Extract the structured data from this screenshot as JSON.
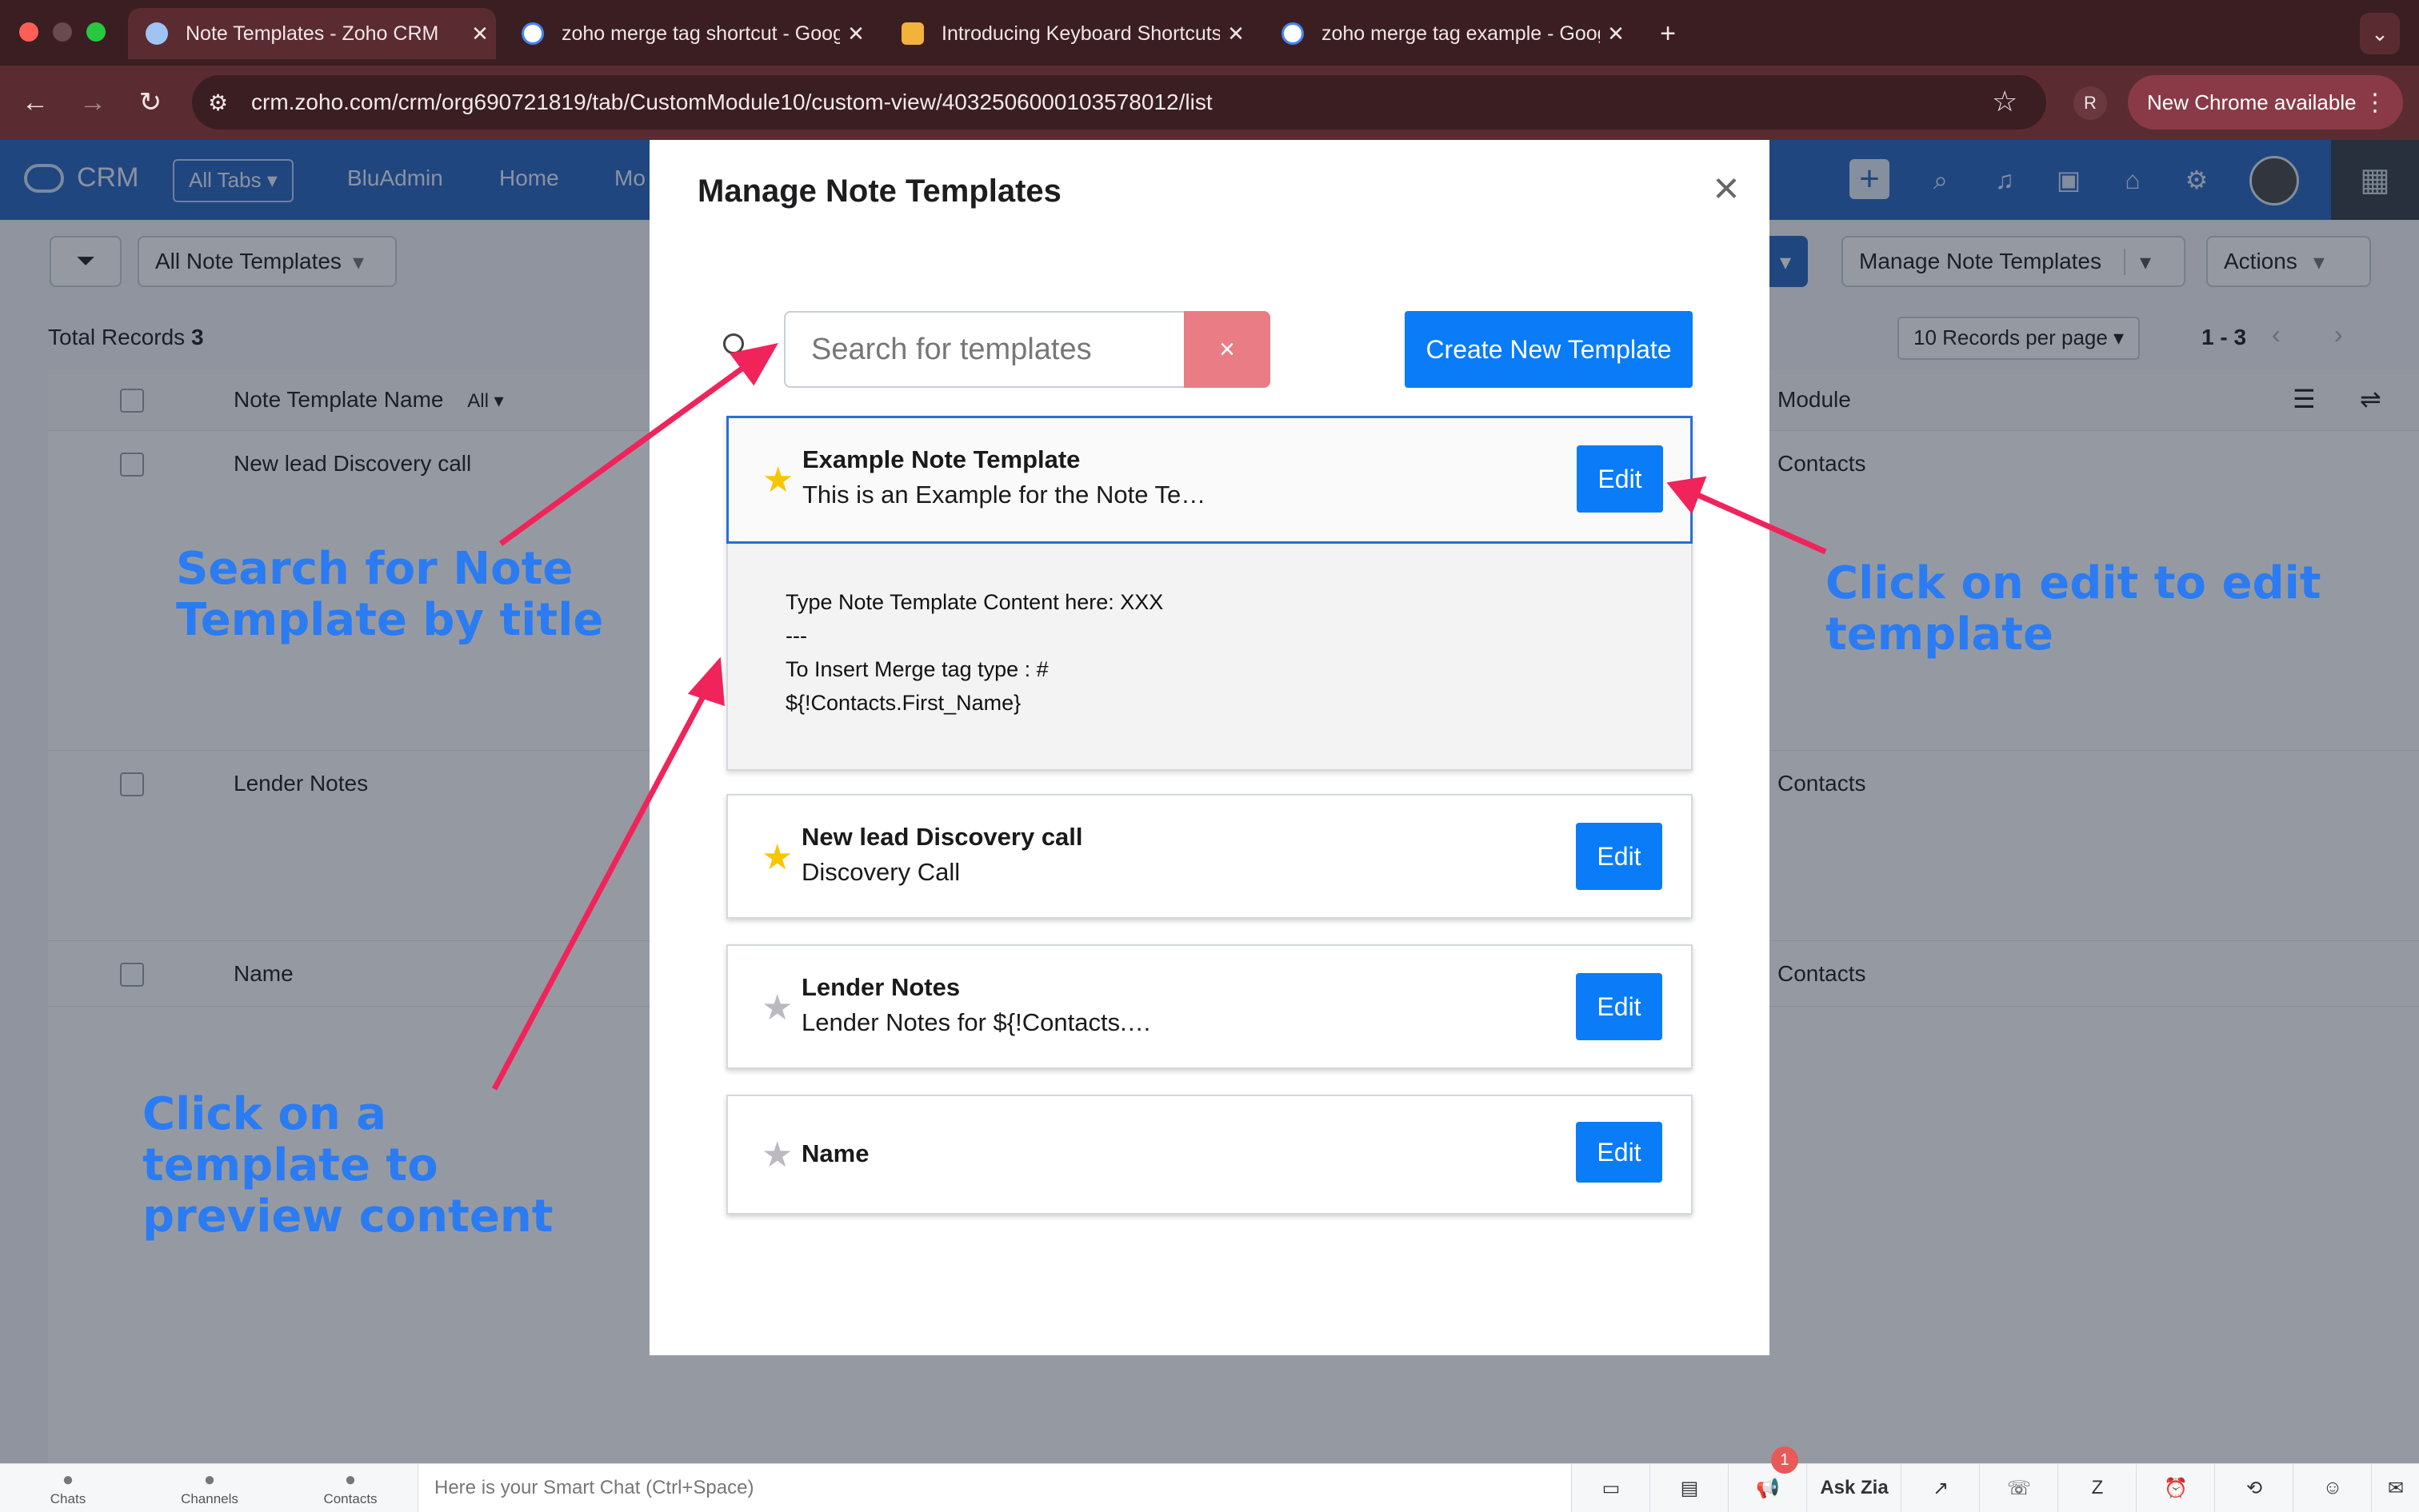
{
  "browser": {
    "tabs": [
      {
        "title": "Note Templates - Zoho CRM",
        "active": true
      },
      {
        "title": "zoho merge tag shortcut - Google Search",
        "active": false
      },
      {
        "title": "Introducing Keyboard Shortcuts",
        "active": false
      },
      {
        "title": "zoho merge tag example - Google Search",
        "active": false
      }
    ],
    "url": "crm.zoho.com/crm/org690721819/tab/CustomModule10/custom-view/4032506000103578012/list",
    "profile_initial": "R",
    "new_chrome_label": "New Chrome available"
  },
  "crm_header": {
    "brand": "CRM",
    "all_tabs_label": "All Tabs",
    "nav_items": [
      "BluAdmin",
      "Home",
      "Mo"
    ]
  },
  "toolbar": {
    "view_label": "All Note Templates",
    "manage_label": "Manage Note Templates",
    "actions_label": "Actions"
  },
  "list": {
    "total_label": "Total Records",
    "total_count": "3",
    "per_page": "10 Records per page",
    "range": "1 - 3",
    "col_name": "Note Template Name",
    "col_filter": "All",
    "col_module": "Module",
    "rows": [
      {
        "name": "New lead Discovery call",
        "module": "Contacts"
      },
      {
        "name": "Lender Notes",
        "module": "Contacts"
      },
      {
        "name": "Name",
        "module": "Contacts"
      }
    ]
  },
  "modal": {
    "title": "Manage Note Templates",
    "search_placeholder": "Search for templates",
    "clear_label": "×",
    "create_label": "Create New Template",
    "edit_label": "Edit",
    "templates": [
      {
        "title": "Example Note Template",
        "subtitle": "This is an Example for the Note Te…",
        "favorite": true
      },
      {
        "title": "New lead Discovery call",
        "subtitle": "Discovery Call",
        "favorite": true
      },
      {
        "title": "Lender Notes",
        "subtitle": "Lender Notes for ${!Contacts.…",
        "favorite": false
      },
      {
        "title": "Name",
        "subtitle": "",
        "favorite": false
      }
    ],
    "preview_lines": [
      "Type Note Template Content here: XXX",
      "---",
      "To Insert Merge tag type : #",
      "${!Contacts.First_Name}"
    ]
  },
  "annotations": {
    "search": "Search for Note Template by title",
    "preview": "Click on a template to preview content",
    "edit": "Click on edit to edit template"
  },
  "bottom_bar": {
    "chats": "Chats",
    "channels": "Channels",
    "contacts": "Contacts",
    "smart_chat_placeholder": "Here is your Smart Chat (Ctrl+Space)",
    "notif_count": "1",
    "ask_zia": "Ask Zia"
  },
  "colors": {
    "accent": "#0a7cf7",
    "crm_header": "#2a66c2",
    "annotation": "#2b7bf2",
    "arrow": "#f0245a",
    "clear": "#e97c84"
  }
}
